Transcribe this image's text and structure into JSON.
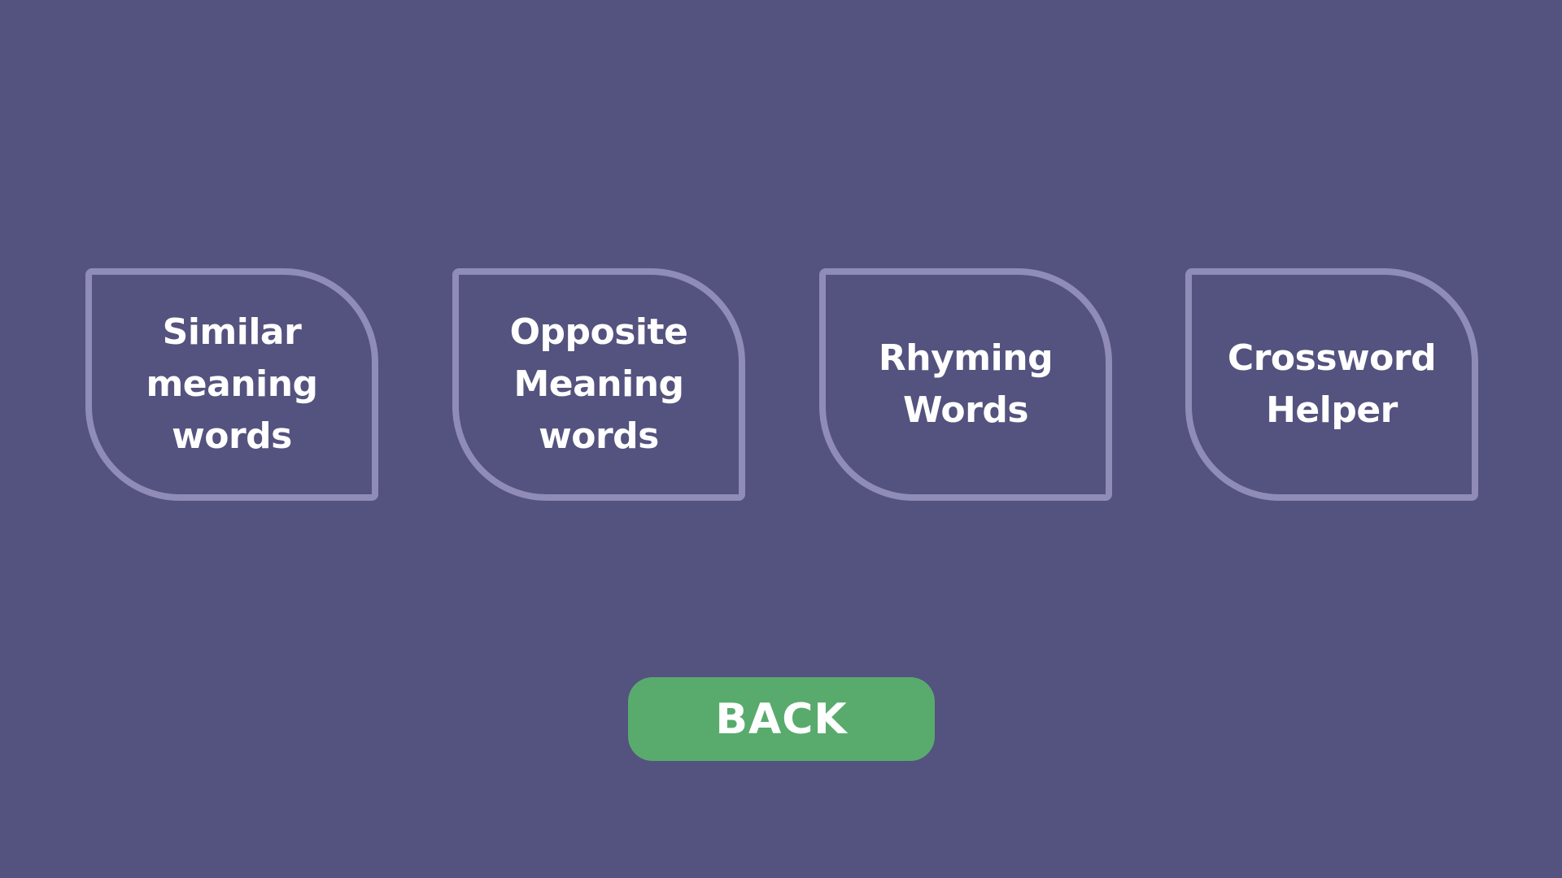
{
  "theme": {
    "background": "#54527e",
    "card_border": "#8f8cb7",
    "text": "#ffffff",
    "back_button": "#59ab6d"
  },
  "menu": {
    "items": [
      {
        "label": "Similar\nmeaning\nwords"
      },
      {
        "label": "Opposite\nMeaning\nwords"
      },
      {
        "label": "Rhyming\nWords"
      },
      {
        "label": "Crossword\nHelper"
      }
    ]
  },
  "back": {
    "label": "BACK"
  }
}
